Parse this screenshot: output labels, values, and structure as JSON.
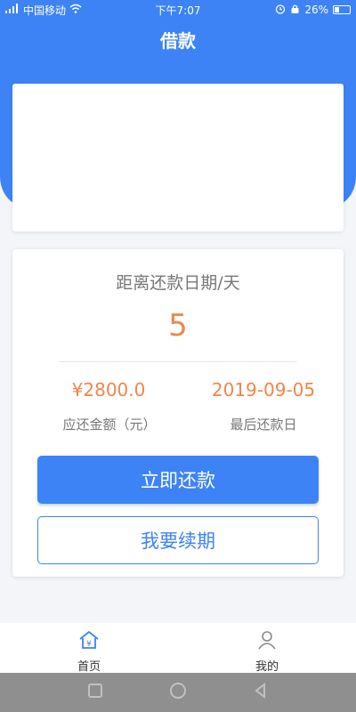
{
  "status_bar": {
    "carrier": "中国移动",
    "time": "下午7:07",
    "battery": "26%"
  },
  "header": {
    "title": "借款"
  },
  "loan": {
    "countdown_label": "距离还款日期/天",
    "countdown_value": "5",
    "amount_value": "¥2800.0",
    "amount_label": "应还金额（元）",
    "due_date_value": "2019-09-05",
    "due_date_label": "最后还款日",
    "repay_button": "立即还款",
    "renew_button": "我要续期"
  },
  "tabs": [
    {
      "label": "首页",
      "icon": "home-yen-icon",
      "active": true
    },
    {
      "label": "我的",
      "icon": "user-icon",
      "active": false
    }
  ],
  "colors": {
    "primary": "#3d83f5",
    "accent": "#f0864b",
    "text_secondary": "#777777"
  }
}
